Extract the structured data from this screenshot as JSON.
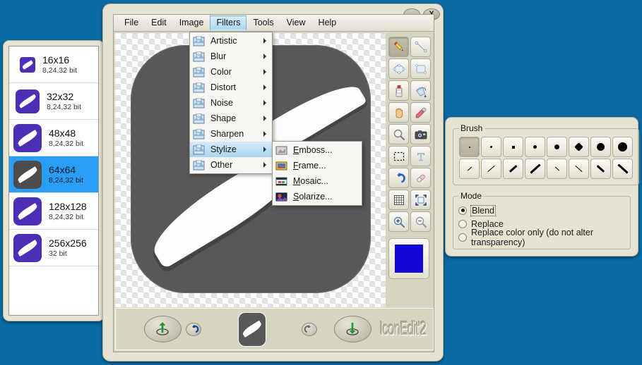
{
  "app": {
    "logo_text": "IconEdit'2",
    "bg_color": "#0a6ba4"
  },
  "sidebar": {
    "items": [
      {
        "name": "16x16",
        "depth": "8,24,32 bit",
        "selected": false
      },
      {
        "name": "32x32",
        "depth": "8,24,32 bit",
        "selected": false
      },
      {
        "name": "48x48",
        "depth": "8,24,32 bit",
        "selected": false
      },
      {
        "name": "64x64",
        "depth": "8,24,32 bit",
        "selected": true
      },
      {
        "name": "128x128",
        "depth": "8,24,32 bit",
        "selected": false
      },
      {
        "name": "256x256",
        "depth": "32 bit",
        "selected": false
      }
    ]
  },
  "window": {
    "minimize_label": "_",
    "close_label": "X",
    "menubar": [
      {
        "label": "File",
        "open": false
      },
      {
        "label": "Edit",
        "open": false
      },
      {
        "label": "Image",
        "open": false
      },
      {
        "label": "Filters",
        "open": true
      },
      {
        "label": "Tools",
        "open": false
      },
      {
        "label": "View",
        "open": false
      },
      {
        "label": "Help",
        "open": false
      }
    ]
  },
  "filters_menu": {
    "items": [
      {
        "label": "Artistic",
        "highlighted": false,
        "has_submenu": true
      },
      {
        "label": "Blur",
        "highlighted": false,
        "has_submenu": true
      },
      {
        "label": "Color",
        "highlighted": false,
        "has_submenu": true
      },
      {
        "label": "Distort",
        "highlighted": false,
        "has_submenu": true
      },
      {
        "label": "Noise",
        "highlighted": false,
        "has_submenu": true
      },
      {
        "label": "Shape",
        "highlighted": false,
        "has_submenu": true
      },
      {
        "label": "Sharpen",
        "highlighted": false,
        "has_submenu": true
      },
      {
        "label": "Stylize",
        "highlighted": true,
        "has_submenu": true
      },
      {
        "label": "Other",
        "highlighted": false,
        "has_submenu": true
      }
    ]
  },
  "stylize_menu": {
    "items": [
      {
        "accel": "E",
        "rest": "mboss..."
      },
      {
        "accel": "F",
        "rest": "rame..."
      },
      {
        "accel": "M",
        "rest": "osaic..."
      },
      {
        "accel": "S",
        "rest": "olarize..."
      }
    ]
  },
  "tools": {
    "items": [
      {
        "name": "pencil-tool",
        "active": true
      },
      {
        "name": "line-tool",
        "active": false
      },
      {
        "name": "ellipse-tool",
        "active": false
      },
      {
        "name": "rectangle-tool",
        "active": false
      },
      {
        "name": "spray-can-tool",
        "active": false
      },
      {
        "name": "paint-bucket-tool",
        "active": false
      },
      {
        "name": "hand-tool",
        "active": false
      },
      {
        "name": "eyedropper-tool",
        "active": false
      },
      {
        "name": "magnifier-tool",
        "active": false
      },
      {
        "name": "screen-capture-tool",
        "active": false
      },
      {
        "name": "select-tool",
        "active": false
      },
      {
        "name": "text-tool",
        "active": false
      },
      {
        "name": "undo-tool",
        "active": false
      },
      {
        "name": "eraser-tool",
        "active": false
      },
      {
        "name": "grid-tool",
        "active": false
      },
      {
        "name": "fit-tool",
        "active": false
      },
      {
        "name": "zoom-in-tool",
        "active": false
      },
      {
        "name": "zoom-out-tool",
        "active": false
      }
    ],
    "foreground_color": "#1408d8"
  },
  "brush_panel": {
    "brush_legend": "Brush",
    "dot_sizes": [
      1,
      2,
      3,
      4,
      5,
      6,
      7,
      8
    ],
    "selected_dot_index": 0,
    "stroke_widths": [
      1,
      1,
      2,
      3,
      1,
      2,
      3,
      4
    ],
    "mode_legend": "Mode",
    "modes": [
      {
        "label": "Blend",
        "selected": true
      },
      {
        "label": "Replace",
        "selected": false
      },
      {
        "label": "Replace color only (do not alter transparency)",
        "selected": false
      }
    ]
  },
  "canvas": {
    "icon_bg_color": "#58585a",
    "brush_color": "#fdfdfd"
  }
}
